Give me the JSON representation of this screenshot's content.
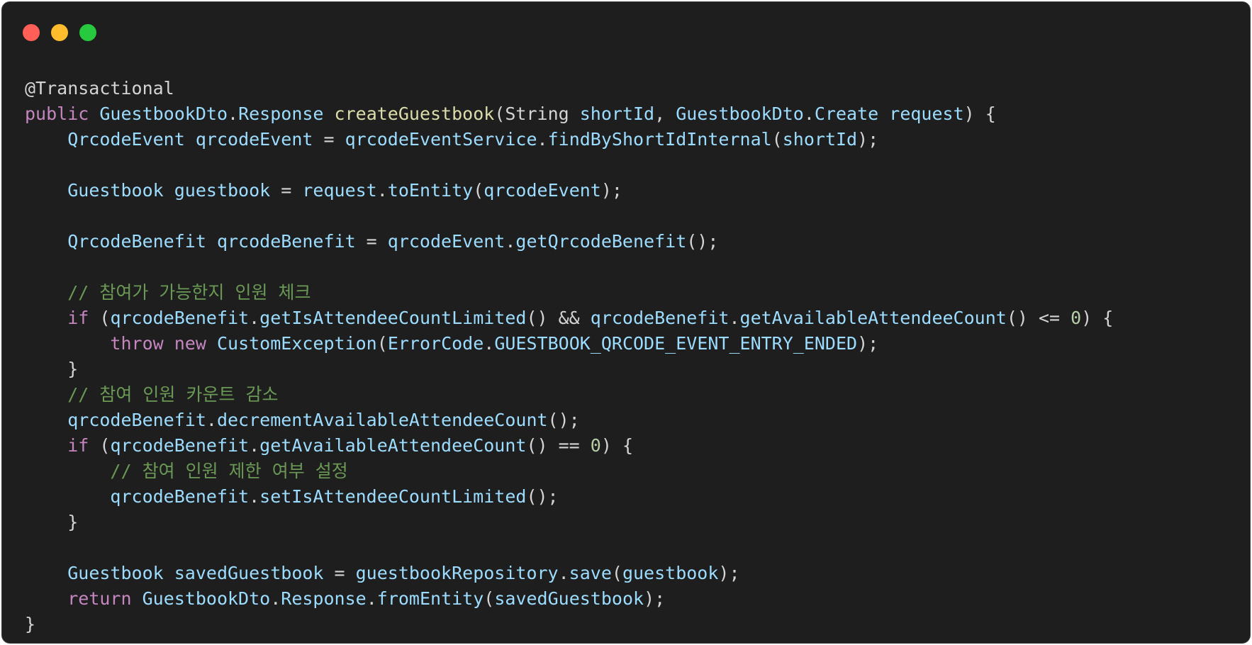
{
  "window": {
    "controls": [
      {
        "name": "close",
        "color": "#ff5f56"
      },
      {
        "name": "minimize",
        "color": "#ffbd2e"
      },
      {
        "name": "maximize",
        "color": "#27c93f"
      }
    ]
  },
  "theme": {
    "background": "#1e1e1e",
    "plain": "#d4d4d4",
    "keyword": "#c586c0",
    "type": "#9cdcfe",
    "function": "#dcdcaa",
    "comment": "#6a9955",
    "number": "#b5cea8"
  },
  "code": {
    "language": "java",
    "lines": [
      [
        {
          "t": "@Transactional",
          "k": "annotation"
        }
      ],
      [
        {
          "t": "public",
          "k": "keyword"
        },
        {
          "t": " ",
          "k": "plain"
        },
        {
          "t": "GuestbookDto",
          "k": "type"
        },
        {
          "t": ".",
          "k": "plain"
        },
        {
          "t": "Response",
          "k": "type"
        },
        {
          "t": " ",
          "k": "plain"
        },
        {
          "t": "createGuestbook",
          "k": "func"
        },
        {
          "t": "(String ",
          "k": "plain"
        },
        {
          "t": "shortId",
          "k": "type"
        },
        {
          "t": ", ",
          "k": "plain"
        },
        {
          "t": "GuestbookDto",
          "k": "type"
        },
        {
          "t": ".",
          "k": "plain"
        },
        {
          "t": "Create",
          "k": "type"
        },
        {
          "t": " ",
          "k": "plain"
        },
        {
          "t": "request",
          "k": "type"
        },
        {
          "t": ") {",
          "k": "plain"
        }
      ],
      [
        {
          "t": "    ",
          "k": "plain"
        },
        {
          "t": "QrcodeEvent",
          "k": "type"
        },
        {
          "t": " ",
          "k": "plain"
        },
        {
          "t": "qrcodeEvent",
          "k": "type"
        },
        {
          "t": " = ",
          "k": "plain"
        },
        {
          "t": "qrcodeEventService",
          "k": "type"
        },
        {
          "t": ".",
          "k": "plain"
        },
        {
          "t": "findByShortIdInternal",
          "k": "type"
        },
        {
          "t": "(",
          "k": "plain"
        },
        {
          "t": "shortId",
          "k": "type"
        },
        {
          "t": ");",
          "k": "plain"
        }
      ],
      [],
      [
        {
          "t": "    ",
          "k": "plain"
        },
        {
          "t": "Guestbook",
          "k": "type"
        },
        {
          "t": " ",
          "k": "plain"
        },
        {
          "t": "guestbook",
          "k": "type"
        },
        {
          "t": " = ",
          "k": "plain"
        },
        {
          "t": "request",
          "k": "type"
        },
        {
          "t": ".",
          "k": "plain"
        },
        {
          "t": "toEntity",
          "k": "type"
        },
        {
          "t": "(",
          "k": "plain"
        },
        {
          "t": "qrcodeEvent",
          "k": "type"
        },
        {
          "t": ");",
          "k": "plain"
        }
      ],
      [],
      [
        {
          "t": "    ",
          "k": "plain"
        },
        {
          "t": "QrcodeBenefit",
          "k": "type"
        },
        {
          "t": " ",
          "k": "plain"
        },
        {
          "t": "qrcodeBenefit",
          "k": "type"
        },
        {
          "t": " = ",
          "k": "plain"
        },
        {
          "t": "qrcodeEvent",
          "k": "type"
        },
        {
          "t": ".",
          "k": "plain"
        },
        {
          "t": "getQrcodeBenefit",
          "k": "type"
        },
        {
          "t": "();",
          "k": "plain"
        }
      ],
      [],
      [
        {
          "t": "    ",
          "k": "plain"
        },
        {
          "t": "// 참여가 가능한지 인원 체크",
          "k": "comment"
        }
      ],
      [
        {
          "t": "    ",
          "k": "plain"
        },
        {
          "t": "if",
          "k": "keyword"
        },
        {
          "t": " (",
          "k": "plain"
        },
        {
          "t": "qrcodeBenefit",
          "k": "type"
        },
        {
          "t": ".",
          "k": "plain"
        },
        {
          "t": "getIsAttendeeCountLimited",
          "k": "type"
        },
        {
          "t": "() && ",
          "k": "plain"
        },
        {
          "t": "qrcodeBenefit",
          "k": "type"
        },
        {
          "t": ".",
          "k": "plain"
        },
        {
          "t": "getAvailableAttendeeCount",
          "k": "type"
        },
        {
          "t": "() <= ",
          "k": "plain"
        },
        {
          "t": "0",
          "k": "number"
        },
        {
          "t": ") {",
          "k": "plain"
        }
      ],
      [
        {
          "t": "        ",
          "k": "plain"
        },
        {
          "t": "throw",
          "k": "keyword"
        },
        {
          "t": " ",
          "k": "plain"
        },
        {
          "t": "new",
          "k": "keyword"
        },
        {
          "t": " ",
          "k": "plain"
        },
        {
          "t": "CustomException",
          "k": "type"
        },
        {
          "t": "(",
          "k": "plain"
        },
        {
          "t": "ErrorCode",
          "k": "type"
        },
        {
          "t": ".",
          "k": "plain"
        },
        {
          "t": "GUESTBOOK_QRCODE_EVENT_ENTRY_ENDED",
          "k": "type"
        },
        {
          "t": ");",
          "k": "plain"
        }
      ],
      [
        {
          "t": "    }",
          "k": "plain"
        }
      ],
      [
        {
          "t": "    ",
          "k": "plain"
        },
        {
          "t": "// 참여 인원 카운트 감소",
          "k": "comment"
        }
      ],
      [
        {
          "t": "    ",
          "k": "plain"
        },
        {
          "t": "qrcodeBenefit",
          "k": "type"
        },
        {
          "t": ".",
          "k": "plain"
        },
        {
          "t": "decrementAvailableAttendeeCount",
          "k": "type"
        },
        {
          "t": "();",
          "k": "plain"
        }
      ],
      [
        {
          "t": "    ",
          "k": "plain"
        },
        {
          "t": "if",
          "k": "keyword"
        },
        {
          "t": " (",
          "k": "plain"
        },
        {
          "t": "qrcodeBenefit",
          "k": "type"
        },
        {
          "t": ".",
          "k": "plain"
        },
        {
          "t": "getAvailableAttendeeCount",
          "k": "type"
        },
        {
          "t": "() == ",
          "k": "plain"
        },
        {
          "t": "0",
          "k": "number"
        },
        {
          "t": ") {",
          "k": "plain"
        }
      ],
      [
        {
          "t": "        ",
          "k": "plain"
        },
        {
          "t": "// 참여 인원 제한 여부 설정",
          "k": "comment"
        }
      ],
      [
        {
          "t": "        ",
          "k": "plain"
        },
        {
          "t": "qrcodeBenefit",
          "k": "type"
        },
        {
          "t": ".",
          "k": "plain"
        },
        {
          "t": "setIsAttendeeCountLimited",
          "k": "type"
        },
        {
          "t": "();",
          "k": "plain"
        }
      ],
      [
        {
          "t": "    }",
          "k": "plain"
        }
      ],
      [],
      [
        {
          "t": "    ",
          "k": "plain"
        },
        {
          "t": "Guestbook",
          "k": "type"
        },
        {
          "t": " ",
          "k": "plain"
        },
        {
          "t": "savedGuestbook",
          "k": "type"
        },
        {
          "t": " = ",
          "k": "plain"
        },
        {
          "t": "guestbookRepository",
          "k": "type"
        },
        {
          "t": ".",
          "k": "plain"
        },
        {
          "t": "save",
          "k": "type"
        },
        {
          "t": "(",
          "k": "plain"
        },
        {
          "t": "guestbook",
          "k": "type"
        },
        {
          "t": ");",
          "k": "plain"
        }
      ],
      [
        {
          "t": "    ",
          "k": "plain"
        },
        {
          "t": "return",
          "k": "keyword"
        },
        {
          "t": " ",
          "k": "plain"
        },
        {
          "t": "GuestbookDto",
          "k": "type"
        },
        {
          "t": ".",
          "k": "plain"
        },
        {
          "t": "Response",
          "k": "type"
        },
        {
          "t": ".",
          "k": "plain"
        },
        {
          "t": "fromEntity",
          "k": "type"
        },
        {
          "t": "(",
          "k": "plain"
        },
        {
          "t": "savedGuestbook",
          "k": "type"
        },
        {
          "t": ");",
          "k": "plain"
        }
      ],
      [
        {
          "t": "}",
          "k": "plain"
        }
      ]
    ]
  }
}
